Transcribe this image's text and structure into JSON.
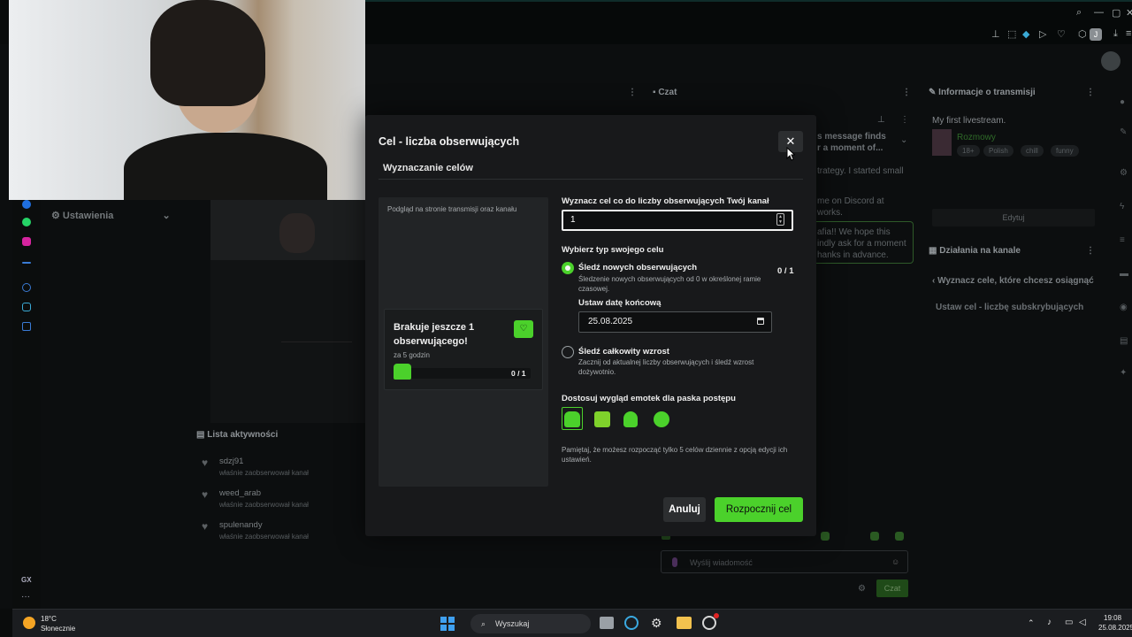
{
  "dashboard": {
    "panels": {
      "chat": "Czat",
      "stream_info": "Informacje o transmisji",
      "channel_actions": "Działania na kanale",
      "settings": "Ustawienia",
      "activity_list": "Lista aktywności"
    },
    "stream_info": {
      "title": "My first livestream.",
      "category": "Rozmowy",
      "tags": [
        "18+",
        "Polish",
        "chill",
        "funny"
      ],
      "edit_button": "Edytuj"
    },
    "channel_actions": {
      "back_item": "Wyznacz cele, które chcesz osiągnąć",
      "item": "Ustaw cel - liczbę subskrybujących"
    },
    "chat": {
      "pinned_fragment_1": "s message finds",
      "pinned_fragment_2": "r a moment of...",
      "msg_fragment_1": "trategy. I started small",
      "msg_fragment_2": "me on Discord at",
      "msg_fragment_3": "works.",
      "msg_fragment_4": "afia!! We hope this",
      "msg_fragment_5": "indly ask for a moment",
      "msg_fragment_6": "hanks in advance.",
      "input_placeholder": "Wyślij wiadomość",
      "send_button": "Czat"
    },
    "activity": [
      {
        "user": "sdzj91",
        "action": "właśnie zaobserwował kanał"
      },
      {
        "user": "weed_arab",
        "action": "właśnie zaobserwował kanał"
      },
      {
        "user": "spulenandy",
        "action": "właśnie zaobserwował kanał"
      }
    ],
    "sidebar_bottom": "GX"
  },
  "browser": {
    "profile_letter": "J"
  },
  "modal": {
    "title": "Cel - liczba obserwujących",
    "section": "Wyznaczanie celów",
    "preview_label": "Podgląd na stronie transmisji oraz kanału",
    "preview_card": {
      "message": "Brakuje jeszcze 1 obserwującego!",
      "time": "za 5 godzin",
      "count": "0 / 1",
      "progress": 0
    },
    "target_label": "Wyznacz cel co do liczby obserwujących Twój kanał",
    "target_value": "1",
    "type_label": "Wybierz typ swojego celu",
    "options": [
      {
        "title": "Śledź nowych obserwujących",
        "desc": "Śledzenie nowych obserwujących od 0 w określonej ramie czasowej.",
        "count": "0 / 1",
        "selected": true
      },
      {
        "title": "Śledź całkowity wzrost",
        "desc": "Zacznij od aktualnej liczby obserwujących i śledź wzrost dożywotnio.",
        "selected": false
      }
    ],
    "end_date_label": "Ustaw datę końcową",
    "end_date_value": "25.08.2025",
    "emote_label": "Dostosuj wygląd emotek dla paska postępu",
    "emotes": [
      "emote-frog-icon",
      "emote-cat-icon",
      "emote-ghost-icon",
      "emote-blob-icon"
    ],
    "note": "Pamiętaj, że możesz rozpocząć tylko 5 celów dziennie z opcją edycji ich ustawień.",
    "cancel_label": "Anuluj",
    "start_label": "Rozpocznij cel",
    "accent_color": "#4bd12b"
  },
  "taskbar": {
    "weather_temp": "18°C",
    "weather_desc": "Słonecznie",
    "search_label": "Wyszukaj",
    "time": "19:08",
    "date": "25.08.2025"
  }
}
